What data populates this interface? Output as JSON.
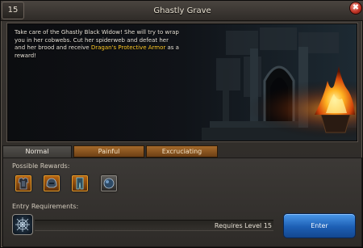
{
  "window": {
    "title": "Ghastly Grave",
    "level": "15",
    "close_glyph": "✖"
  },
  "description": {
    "text_before": "Take care of the Ghastly Black Widow! She will try to wrap you in her cobwebs. Cut her spiderweb and defeat her and her brood and receive ",
    "highlight": "Dragan's Protective Armor",
    "text_after": " as a reward!",
    "highlight_color": "#ffca28"
  },
  "tabs": [
    {
      "label": "Normal",
      "active": true
    },
    {
      "label": "Painful",
      "active": false
    },
    {
      "label": "Excruciating",
      "active": false
    }
  ],
  "rewards": {
    "label": "Possible Rewards:",
    "items": [
      {
        "icon": "armor-chest-icon"
      },
      {
        "icon": "helmet-icon"
      },
      {
        "icon": "leg-armor-icon"
      },
      {
        "icon": "orb-icon"
      }
    ]
  },
  "requirements": {
    "label": "Entry Requirements:",
    "icon": "spiderweb-icon",
    "level_text": "Requires Level 15"
  },
  "enter_button": {
    "label": "Enter",
    "color": "#1d5fb4"
  }
}
